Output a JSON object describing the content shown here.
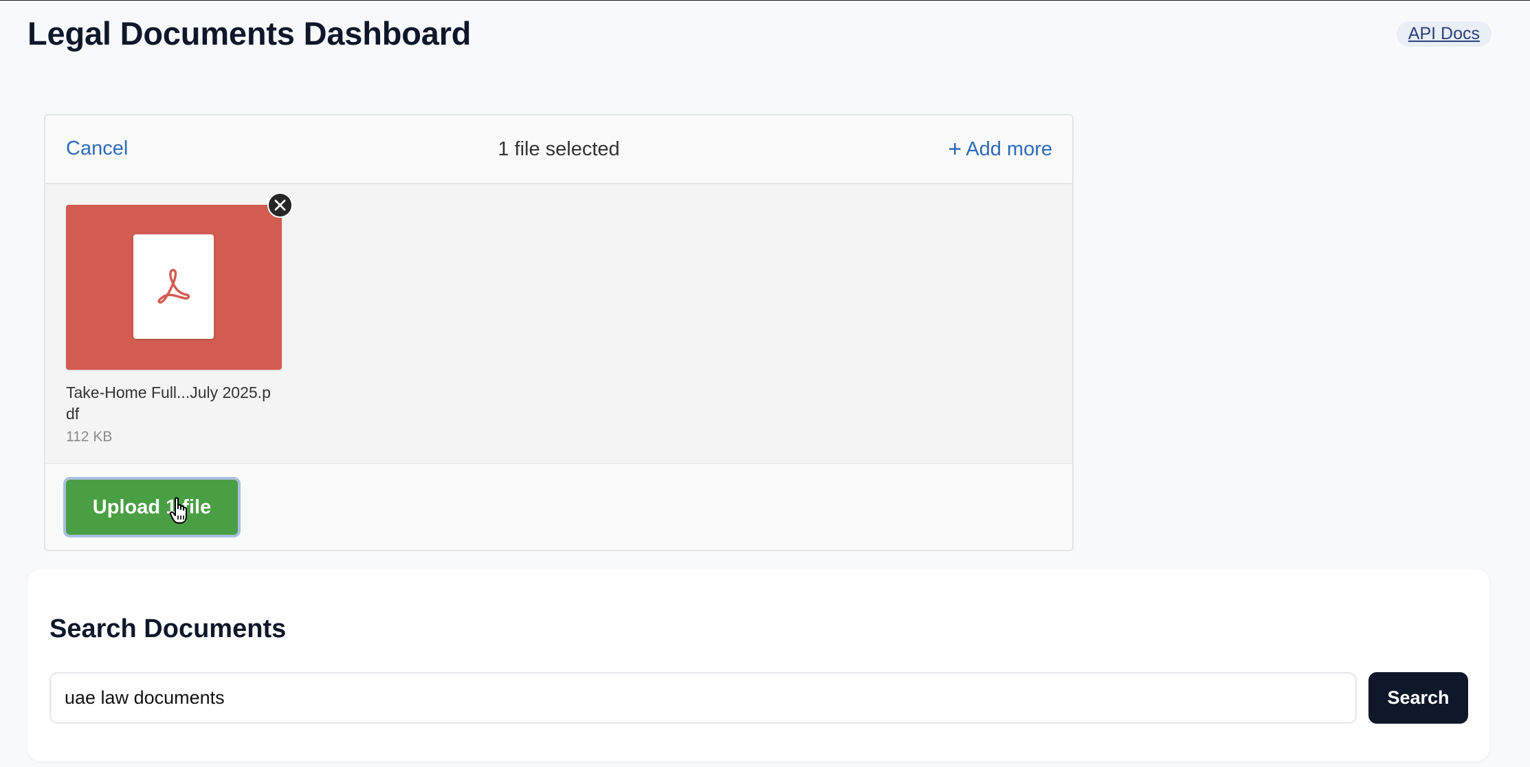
{
  "header": {
    "title": "Legal Documents Dashboard",
    "api_docs_label": "API Docs"
  },
  "uploader": {
    "cancel_label": "Cancel",
    "selected_text": "1 file selected",
    "add_more_label": "Add more",
    "add_more_icon": "plus-icon",
    "files": [
      {
        "name": "Take-Home Full...July 2025.pdf",
        "size": "112 KB",
        "type_icon": "pdf-icon",
        "thumb_color": "#d35c51"
      }
    ],
    "upload_button_label": "Upload 1 file"
  },
  "search": {
    "title": "Search Documents",
    "query_value": "uae law documents",
    "button_label": "Search"
  },
  "colors": {
    "accent_link": "#2c6bb7",
    "upload_green": "#4a9f45",
    "search_button": "#0f172a",
    "pdf_red": "#d35c51"
  }
}
